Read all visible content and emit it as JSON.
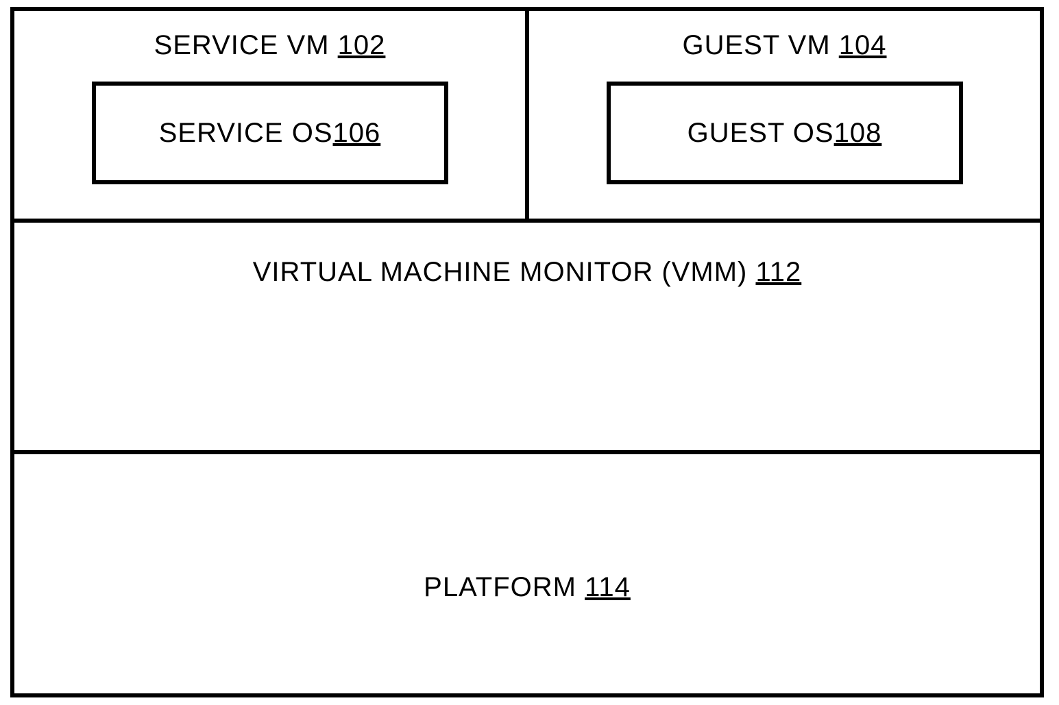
{
  "service_vm": {
    "label": "SERVICE VM ",
    "ref": "102"
  },
  "guest_vm": {
    "label": "GUEST VM ",
    "ref": "104"
  },
  "service_os": {
    "label": "SERVICE OS ",
    "ref": "106"
  },
  "guest_os": {
    "label": "GUEST OS ",
    "ref": "108"
  },
  "vmm": {
    "label": "VIRTUAL MACHINE MONITOR (VMM)  ",
    "ref": "112"
  },
  "platform": {
    "label": "PLATFORM  ",
    "ref": "114"
  }
}
